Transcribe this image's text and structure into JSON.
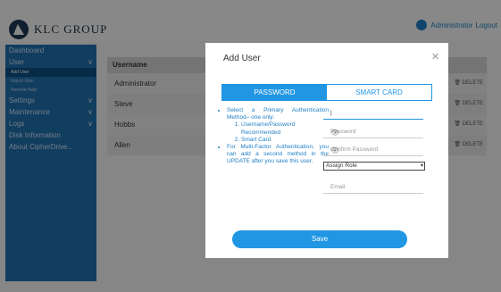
{
  "brand": {
    "name": "KLC GROUP"
  },
  "header": {
    "admin_label": "Administrator",
    "logout_label": "Logout"
  },
  "sidebar": {
    "items": [
      {
        "label": "Dashboard"
      },
      {
        "label": "User",
        "chevron": "∨"
      },
      {
        "label": "Add User"
      },
      {
        "label": "Import User"
      },
      {
        "label": "Remote Help"
      },
      {
        "label": "Settings",
        "chevron": "∨"
      },
      {
        "label": "Maintenance",
        "chevron": "∨"
      },
      {
        "label": "Logs",
        "chevron": "∨"
      },
      {
        "label": "Disk Information"
      },
      {
        "label": "About CipherDrive..."
      }
    ]
  },
  "table": {
    "header": "Username",
    "rows": [
      "Administrator",
      "Steve",
      "Hobbs",
      "Allen"
    ],
    "delete_label": "DELETE"
  },
  "modal": {
    "title": "Add User",
    "close_label": "×",
    "tabs": [
      "PASSWORD",
      "SMART CARD"
    ],
    "info": {
      "bullet1": "Select a Primary Authentication Method– one only:",
      "sub1": "Username/Password Recommended",
      "sub2": "Smart Card",
      "bullet2": "For Multi-Factor Authentication, you can add a second method in the UPDATE after you save this user."
    },
    "fields": {
      "username_placeholder": "",
      "password_placeholder": "Password",
      "confirm_placeholder": "Confirm Password",
      "role_label": "Assign Role",
      "email_placeholder": "Email"
    },
    "save_label": "Save"
  },
  "icons": {
    "logo": "klc-logo-icon",
    "admin": "user-icon",
    "eye": "eye-icon",
    "trash": "trash-icon"
  },
  "colors": {
    "accent": "#2196e3",
    "sidebar": "#1f6fae"
  }
}
